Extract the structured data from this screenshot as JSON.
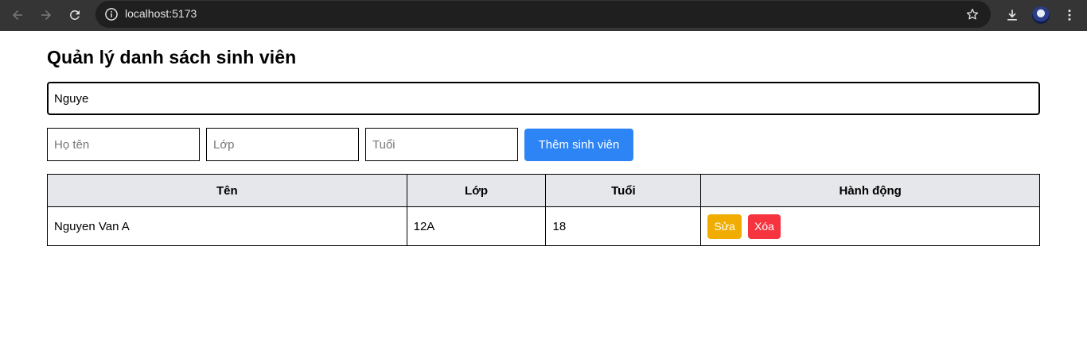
{
  "browser": {
    "url": "localhost:5173"
  },
  "app": {
    "title": "Quản lý danh sách sinh viên",
    "search": {
      "value": "Nguye"
    },
    "form": {
      "name_placeholder": "Họ tên",
      "class_placeholder": "Lớp",
      "age_placeholder": "Tuổi",
      "add_label": "Thêm sinh viên"
    },
    "table": {
      "headers": [
        "Tên",
        "Lớp",
        "Tuổi",
        "Hành động"
      ],
      "rows": [
        {
          "name": "Nguyen Van A",
          "class": "12A",
          "age": "18",
          "edit_label": "Sửa",
          "delete_label": "Xóa"
        }
      ]
    }
  },
  "colors": {
    "add_button": "#2d84f5",
    "edit_button": "#f0ad00",
    "delete_button": "#f6343f",
    "header_bg": "#e5e7eb"
  }
}
